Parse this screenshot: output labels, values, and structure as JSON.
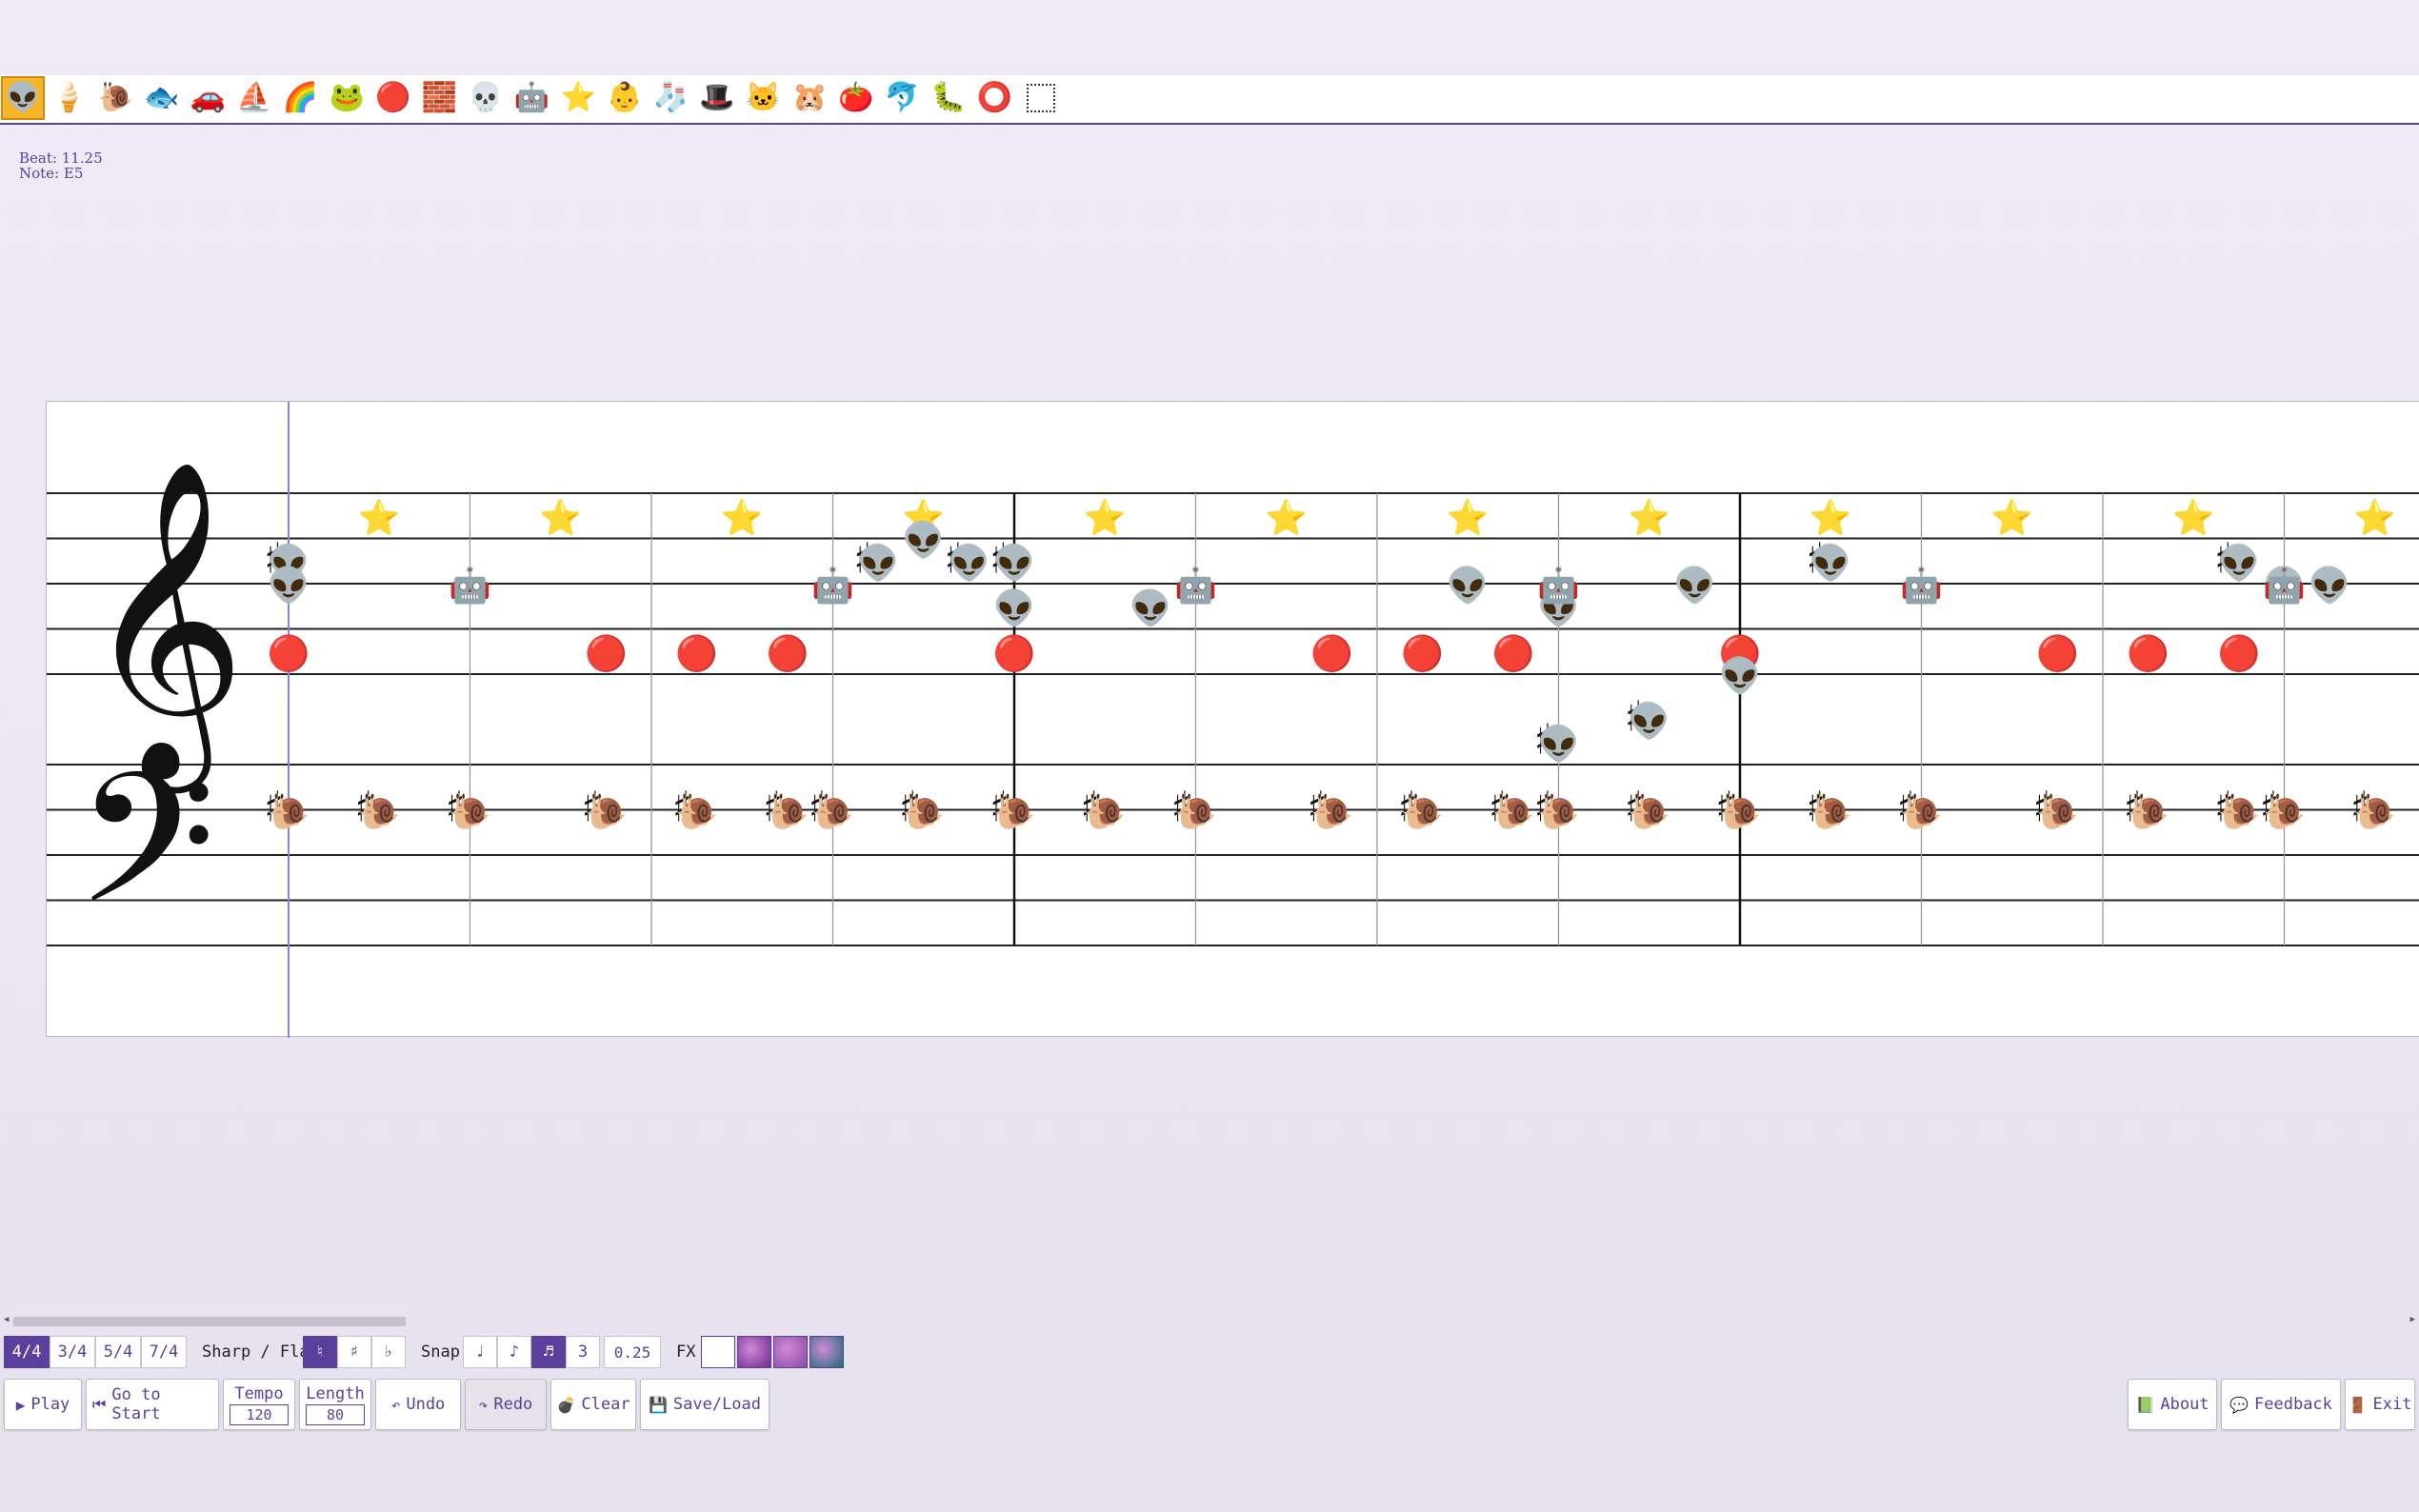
{
  "palette": [
    {
      "icon": "alien-icon",
      "glyph": "👽",
      "selected": true
    },
    {
      "icon": "ice-cream-icon",
      "glyph": "🍦"
    },
    {
      "icon": "snail-icon",
      "glyph": "🐌"
    },
    {
      "icon": "fish-icon",
      "glyph": "🐟"
    },
    {
      "icon": "car-icon",
      "glyph": "🚗"
    },
    {
      "icon": "boat-icon",
      "glyph": "⛵"
    },
    {
      "icon": "rainbow-icon",
      "glyph": "🌈"
    },
    {
      "icon": "frog-icon",
      "glyph": "🐸"
    },
    {
      "icon": "ball-icon",
      "glyph": "🔴"
    },
    {
      "icon": "brick-icon",
      "glyph": "🧱"
    },
    {
      "icon": "skull-icon",
      "glyph": "💀"
    },
    {
      "icon": "robot-icon",
      "glyph": "🤖"
    },
    {
      "icon": "star-icon",
      "glyph": "⭐"
    },
    {
      "icon": "baby-icon",
      "glyph": "👶"
    },
    {
      "icon": "sock-icon",
      "glyph": "🧦"
    },
    {
      "icon": "top-hat-icon",
      "glyph": "🎩"
    },
    {
      "icon": "cat-icon",
      "glyph": "🐱"
    },
    {
      "icon": "hamster-icon",
      "glyph": "🐹"
    },
    {
      "icon": "tomato-icon",
      "glyph": "🍅"
    },
    {
      "icon": "dolphin-icon",
      "glyph": "🐬"
    },
    {
      "icon": "worm-icon",
      "glyph": "🐛"
    },
    {
      "icon": "ring-icon",
      "glyph": "⭕"
    },
    {
      "icon": "marquee-select-icon",
      "glyph": ""
    }
  ],
  "info": {
    "beat": "Beat: 11.25",
    "note": "Note: E5"
  },
  "time_signatures": [
    "4/4",
    "3/4",
    "5/4",
    "7/4"
  ],
  "time_signature_selected": "4/4",
  "accidental": {
    "label": "Sharp / Flat",
    "options": [
      "♮",
      "♯",
      "♭"
    ],
    "selected": "♮"
  },
  "snap": {
    "label": "Snap",
    "options": [
      "♩",
      "♪",
      "♬",
      "3"
    ],
    "selected": "♬",
    "value": "0.25"
  },
  "fx": {
    "label": "FX",
    "swatches": [
      "#ffffff",
      "#6a2a8c",
      "#8a4aa0",
      "#1d6a75"
    ]
  },
  "buttons": {
    "play": "Play",
    "goto_start": "Go to Start",
    "tempo_label": "Tempo",
    "tempo_value": "120",
    "length_label": "Length",
    "length_value": "80",
    "undo": "Undo",
    "redo": "Redo",
    "clear": "Clear",
    "save_load": "Save/Load",
    "about": "About",
    "feedback": "Feedback",
    "exit": "Exit"
  },
  "colors": {
    "accent": "#5a3f9c",
    "playhead": "#8a80d8"
  },
  "notes": [
    {
      "icon": "star-icon",
      "glyph": "⭐",
      "beats": [
        0.5,
        1.5,
        2.5,
        3.5,
        4.5,
        5.5,
        6.5,
        7.5,
        8.5,
        9.5,
        10.5,
        11.5
      ],
      "pitch": "E5"
    },
    {
      "icon": "alien-icon",
      "glyph": "👽",
      "beats": [
        3.5
      ],
      "pitch": "D5"
    },
    {
      "icon": "alien-icon",
      "glyph": "👽",
      "beats": [
        0,
        3.25,
        3.75,
        4,
        8.5,
        10.75
      ],
      "pitch": "C5",
      "sharp": true
    },
    {
      "icon": "alien-icon",
      "glyph": "👽",
      "beats": [
        0,
        6.5,
        7.75,
        11,
        11.25
      ],
      "pitch": "B4"
    },
    {
      "icon": "alien-icon",
      "glyph": "👽",
      "beats": [
        4,
        4.75,
        7
      ],
      "pitch": "A4"
    },
    {
      "icon": "robot-icon",
      "glyph": "🤖",
      "beats": [
        1,
        3,
        5,
        7,
        9,
        11
      ],
      "pitch": "B4"
    },
    {
      "icon": "ball-icon",
      "glyph": "🔴",
      "beats": [
        0,
        1.75,
        2.25,
        2.75,
        4,
        5.75,
        6.25,
        6.75,
        8,
        9.75,
        10.25,
        10.75
      ],
      "pitch": "F4"
    },
    {
      "icon": "alien-icon",
      "glyph": "👽",
      "beats": [
        8
      ],
      "pitch": "E4"
    },
    {
      "icon": "alien-icon",
      "glyph": "👽",
      "beats": [
        7.5
      ],
      "pitch": "C4",
      "sharp": true
    },
    {
      "icon": "alien-icon",
      "glyph": "👽",
      "beats": [
        7
      ],
      "pitch": "B3",
      "sharp": true
    },
    {
      "icon": "snail-icon",
      "glyph": "🐌",
      "beats": [
        0,
        0.5,
        1,
        1.75,
        2.25,
        2.75,
        3,
        3.5,
        4,
        4.5,
        5,
        5.75,
        6.25,
        6.75,
        7,
        7.5,
        8,
        8.5,
        9,
        9.75,
        10.25,
        10.75,
        11,
        11.5
      ],
      "pitch": "F3",
      "sharp": true
    }
  ]
}
